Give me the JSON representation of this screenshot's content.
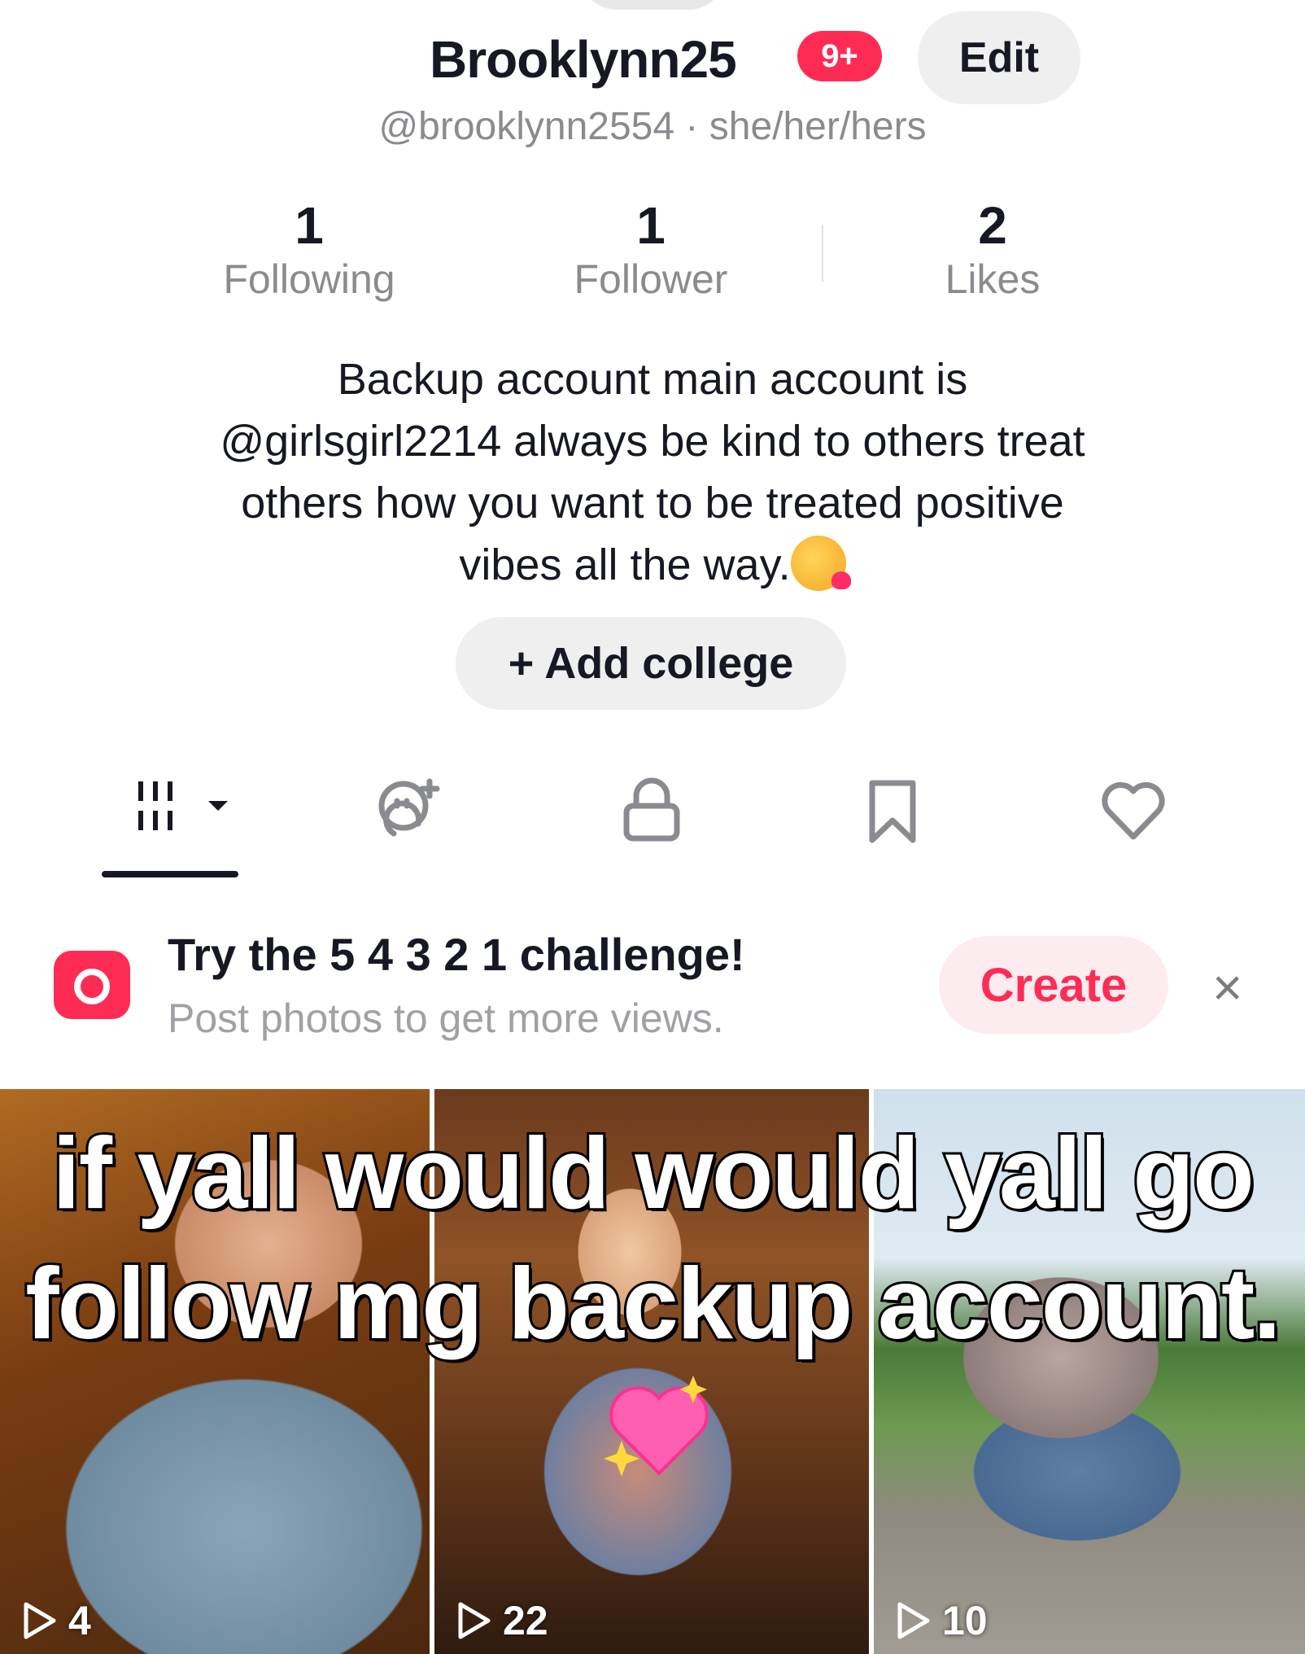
{
  "profile": {
    "username": "Brooklynn25",
    "notification_badge": "9+",
    "edit_label": "Edit",
    "handle": "@brooklynn2554",
    "pronouns": "she/her/hers",
    "separator": "·"
  },
  "stats": [
    {
      "value": "1",
      "label": "Following"
    },
    {
      "value": "1",
      "label": "Follower"
    },
    {
      "value": "2",
      "label": "Likes"
    }
  ],
  "bio": {
    "lines": [
      "Backup account main account is",
      "@girlsgirl2214 always be kind to others treat",
      "others how you want to be treated positive",
      "vibes all the way."
    ],
    "emoji": "face-blowing-kiss"
  },
  "add_college_label": "+ Add college",
  "tabs": [
    {
      "icon": "grid-icon",
      "selected": true
    },
    {
      "icon": "reposts-icon"
    },
    {
      "icon": "lock-icon"
    },
    {
      "icon": "bookmark-icon"
    },
    {
      "icon": "heart-icon"
    }
  ],
  "challenge_banner": {
    "title": "Try the 5 4 3 2 1 challenge!",
    "subtitle": "Post photos to get more views.",
    "create_label": "Create",
    "close_label": "×"
  },
  "overlay_caption": {
    "line1": "if yall would would yall go",
    "line2": "follow mg backup account."
  },
  "videos": [
    {
      "views": "4"
    },
    {
      "views": "22"
    },
    {
      "views": "10"
    }
  ],
  "colors": {
    "accent": "#fe2c55",
    "text": "#161823",
    "secondary": "#8a8b91",
    "pill_bg": "#efefef"
  }
}
